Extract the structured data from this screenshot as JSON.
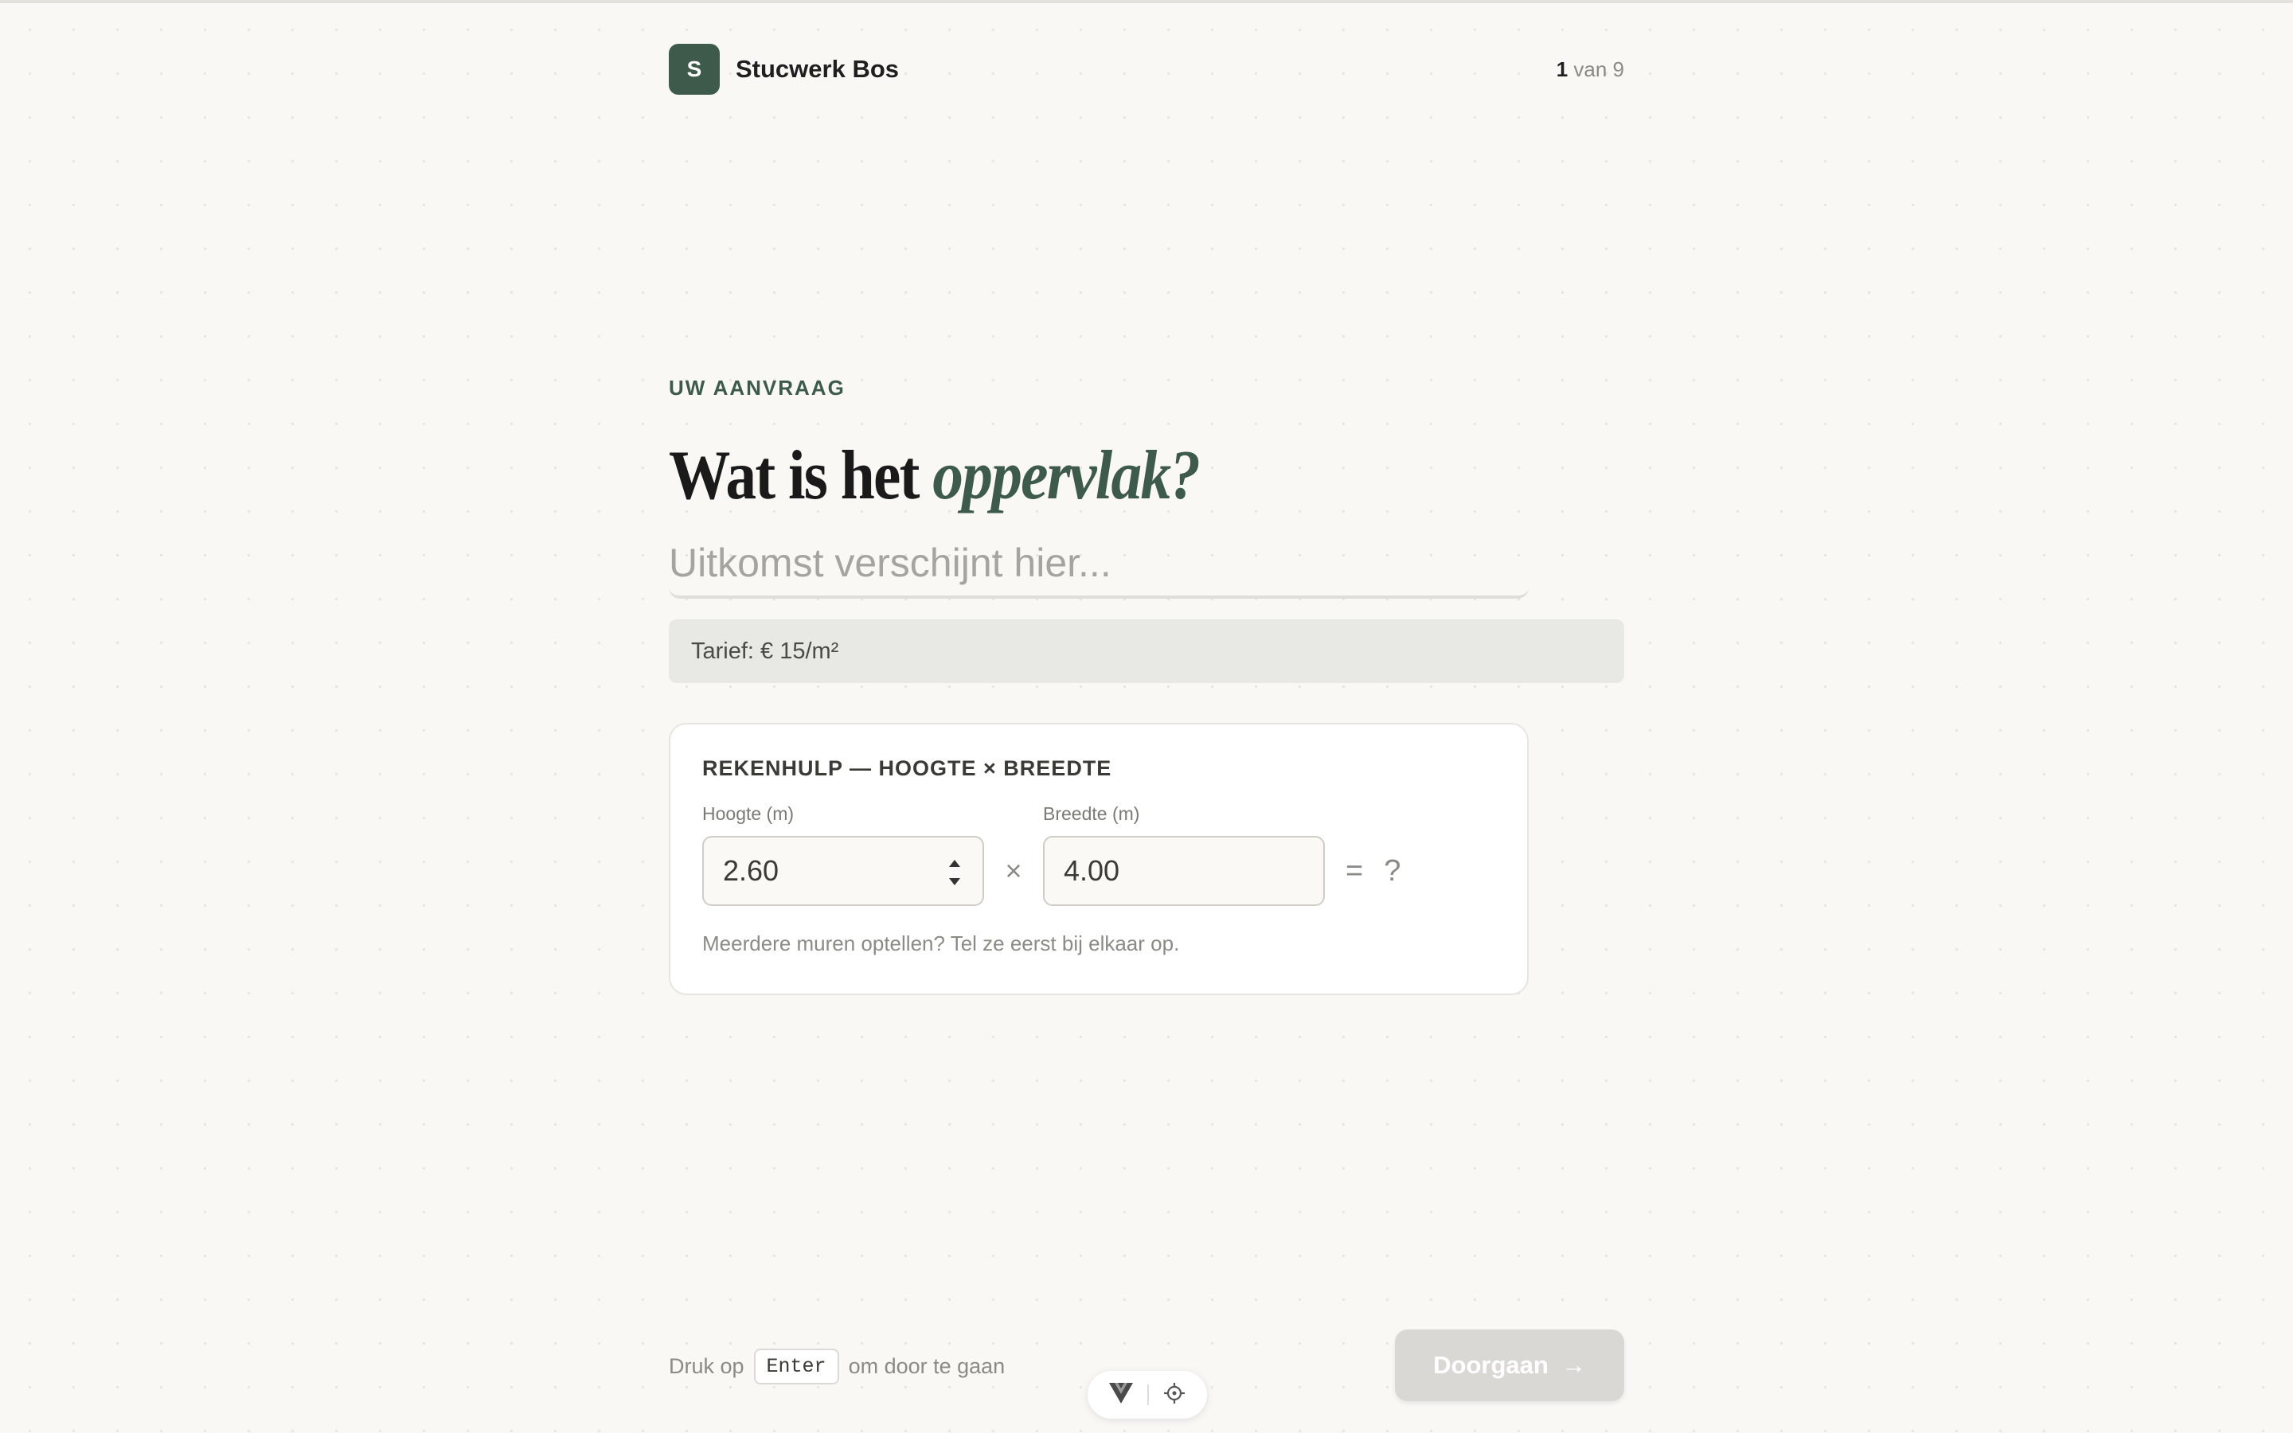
{
  "brand": {
    "logo_letter": "S",
    "name": "Stucwerk Bos"
  },
  "progress": {
    "current": "1",
    "rest": "van 9"
  },
  "question": {
    "eyebrow": "UW AANVRAAG",
    "title_plain": "Wat is het ",
    "title_accent": "oppervlak?",
    "answer_placeholder": "Uitkomst verschijnt hier...",
    "answer_value": ""
  },
  "tariff": "Tarief: € 15/m²",
  "calculator": {
    "title": "REKENHULP — HOOGTE × BREEDTE",
    "height_label": "Hoogte (m)",
    "height_value": "2.60",
    "times": "×",
    "width_label": "Breedte (m)",
    "width_value": "4.00",
    "equals": "=",
    "result": "?",
    "hint": "Meerdere muren optellen? Tel ze eerst bij elkaar op."
  },
  "footer": {
    "hint_before": "Druk op",
    "key": "Enter",
    "hint_after": "om door te gaan",
    "continue_label": "Doorgaan",
    "continue_arrow": "→"
  },
  "colors": {
    "accent": "#3d5a4a",
    "background": "#f9f8f5",
    "continue_disabled": "#d9d8d4"
  },
  "icons": [
    "vue-logo-icon",
    "crosshair-icon",
    "arrow-right-icon",
    "spinner-icon"
  ]
}
